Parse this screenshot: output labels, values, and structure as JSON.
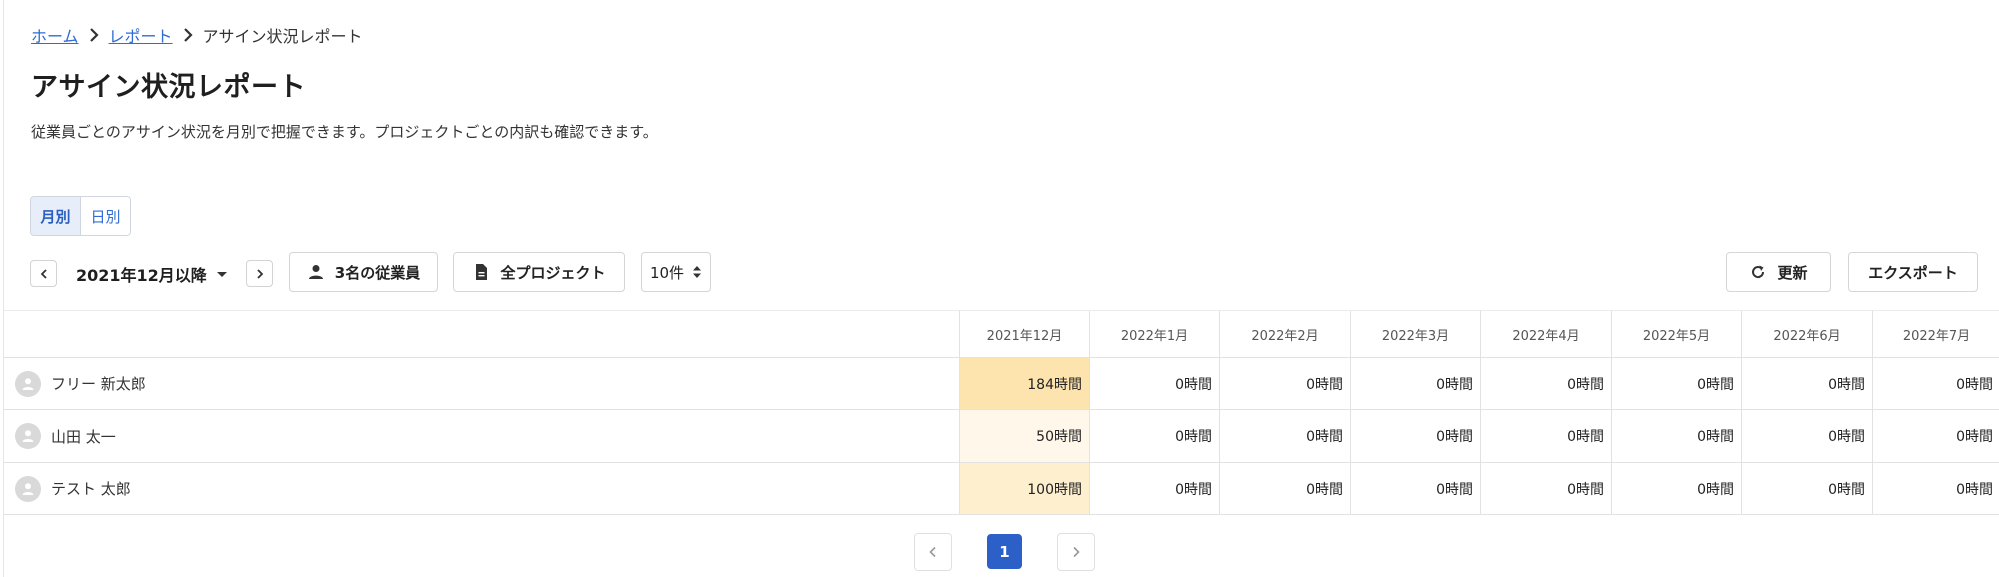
{
  "breadcrumb": {
    "home": "ホーム",
    "reports": "レポート",
    "current": "アサイン状況レポート"
  },
  "page": {
    "title": "アサイン状況レポート",
    "description": "従業員ごとのアサイン状況を月別で把握できます。プロジェクトごとの内訳も確認できます。"
  },
  "view_toggle": {
    "monthly": "月別",
    "daily": "日別",
    "selected": "monthly"
  },
  "toolbar": {
    "period": "2021年12月以降",
    "employees": "3名の従業員",
    "projects": "全プロジェクト",
    "per_page": "10件",
    "refresh": "更新",
    "export": "エクスポート"
  },
  "table": {
    "months": [
      "2021年12月",
      "2022年1月",
      "2022年2月",
      "2022年3月",
      "2022年4月",
      "2022年5月",
      "2022年6月",
      "2022年7月"
    ],
    "rows": [
      {
        "name": "フリー 新太郎",
        "hours": [
          "184時間",
          "0時間",
          "0時間",
          "0時間",
          "0時間",
          "0時間",
          "0時間",
          "0時間"
        ]
      },
      {
        "name": "山田 太一",
        "hours": [
          "50時間",
          "0時間",
          "0時間",
          "0時間",
          "0時間",
          "0時間",
          "0時間",
          "0時間"
        ]
      },
      {
        "name": "テスト 太郎",
        "hours": [
          "100時間",
          "0時間",
          "0時間",
          "0時間",
          "0時間",
          "0時間",
          "0時間",
          "0時間"
        ]
      }
    ],
    "highlight_colors": [
      "#fde4ae",
      "#fff7ea",
      "#feefcf"
    ]
  },
  "pagination": {
    "current": "1"
  },
  "colors": {
    "link": "#2f6cd3",
    "primary": "#2d5fc9",
    "toggle_active_bg": "#e7eef9"
  }
}
